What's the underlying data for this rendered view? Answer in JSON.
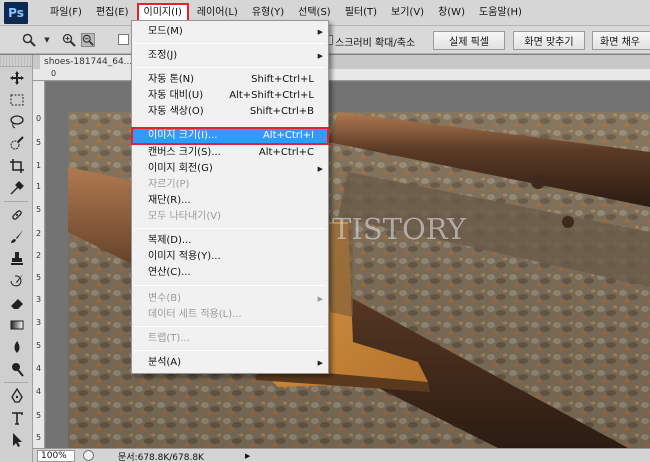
{
  "app": {
    "logo": "Ps"
  },
  "menubar": {
    "items": [
      {
        "label": "파일(F)"
      },
      {
        "label": "편집(E)"
      },
      {
        "label": "이미지(I)"
      },
      {
        "label": "레이어(L)"
      },
      {
        "label": "유형(Y)"
      },
      {
        "label": "선택(S)"
      },
      {
        "label": "필터(T)"
      },
      {
        "label": "보기(V)"
      },
      {
        "label": "창(W)"
      },
      {
        "label": "도움말(H)"
      }
    ]
  },
  "options": {
    "scroll_zoom_label": "스크러비 확대/축소",
    "actual_pixels": "실제 픽셀",
    "fit_screen": "화면 맞추기",
    "fill_screen": "화면 채우"
  },
  "document": {
    "tab_title": "shoes-181744_64..."
  },
  "ruler": {
    "top_ticks": [
      "0"
    ],
    "left_ticks": [
      "0",
      "5",
      "1",
      "1",
      "5",
      "2",
      "2",
      "5",
      "3",
      "3",
      "5",
      "4",
      "4",
      "5",
      "5"
    ]
  },
  "status": {
    "zoom": "100%",
    "doc_info": "문서:678.8K/678.8K"
  },
  "image_menu": {
    "items": [
      {
        "label": "모드(M)",
        "shortcut": "",
        "submenu": true,
        "disabled": false
      },
      {
        "label": "조정(J)",
        "shortcut": "",
        "submenu": true,
        "disabled": false
      },
      {
        "label": "자동 톤(N)",
        "shortcut": "Shift+Ctrl+L",
        "submenu": false,
        "disabled": false
      },
      {
        "label": "자동 대비(U)",
        "shortcut": "Alt+Shift+Ctrl+L",
        "submenu": false,
        "disabled": false
      },
      {
        "label": "자동 색상(O)",
        "shortcut": "Shift+Ctrl+B",
        "submenu": false,
        "disabled": false
      },
      {
        "label": "이미지 크기(I)...",
        "shortcut": "Alt+Ctrl+I",
        "submenu": false,
        "disabled": false,
        "highlighted": true
      },
      {
        "label": "캔버스 크기(S)...",
        "shortcut": "Alt+Ctrl+C",
        "submenu": false,
        "disabled": false
      },
      {
        "label": "이미지 회전(G)",
        "shortcut": "",
        "submenu": true,
        "disabled": false
      },
      {
        "label": "자르기(P)",
        "shortcut": "",
        "submenu": false,
        "disabled": true
      },
      {
        "label": "재단(R)...",
        "shortcut": "",
        "submenu": false,
        "disabled": false
      },
      {
        "label": "모두 나타내기(V)",
        "shortcut": "",
        "submenu": false,
        "disabled": true
      },
      {
        "label": "복제(D)...",
        "shortcut": "",
        "submenu": false,
        "disabled": false
      },
      {
        "label": "이미지 적용(Y)...",
        "shortcut": "",
        "submenu": false,
        "disabled": false
      },
      {
        "label": "연산(C)...",
        "shortcut": "",
        "submenu": false,
        "disabled": false
      },
      {
        "label": "변수(B)",
        "shortcut": "",
        "submenu": true,
        "disabled": true
      },
      {
        "label": "데이터 세트 적용(L)...",
        "shortcut": "",
        "submenu": false,
        "disabled": true
      },
      {
        "label": "트랩(T)...",
        "shortcut": "",
        "submenu": false,
        "disabled": true
      },
      {
        "label": "분석(A)",
        "shortcut": "",
        "submenu": true,
        "disabled": false
      }
    ]
  },
  "watermark": "RITLOG.TISTORY",
  "colors": {
    "accent_highlight": "#3399ff",
    "annotation_red": "#e0242a"
  }
}
